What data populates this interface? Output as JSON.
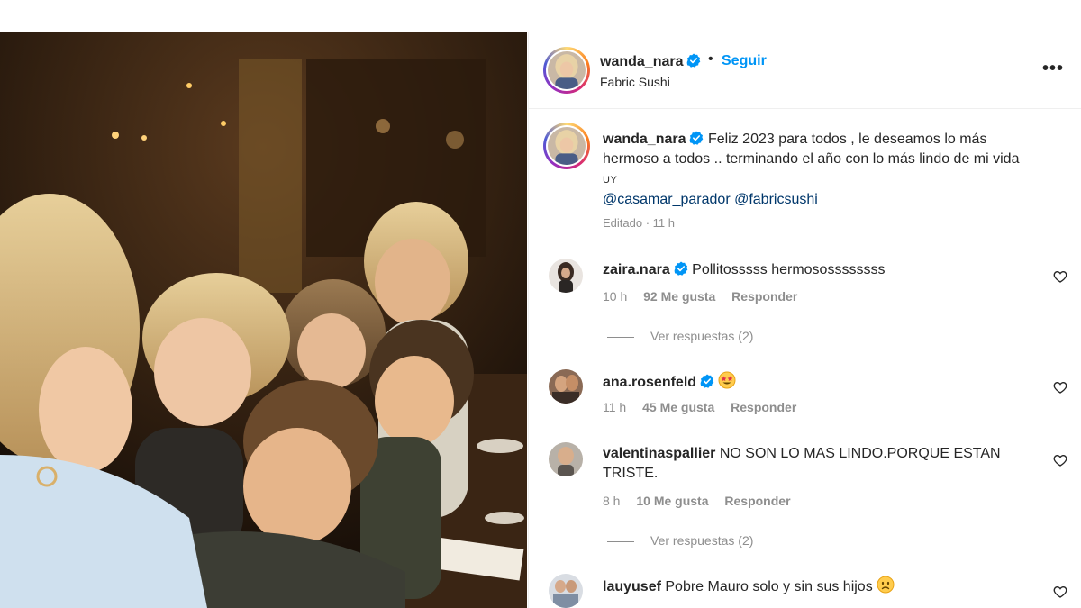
{
  "post": {
    "author": "wanda_nara",
    "follow_label": "Seguir",
    "dot": "•",
    "location": "Fabric Sushi",
    "more_label": "•••"
  },
  "caption": {
    "author": "wanda_nara",
    "text": "Feliz 2023 para todos , le deseamos lo más hermoso a todos .. terminando el año con lo más lindo de mi vida",
    "flag": "UY",
    "mention1": "@casamar_parador",
    "mention2": "@fabricsushi",
    "edited": "Editado",
    "time": "11 h"
  },
  "comments": [
    {
      "user": "zaira.nara",
      "verified": true,
      "text": "Pollitosssss hermosossssssss",
      "time": "10 h",
      "likes": "92 Me gusta",
      "reply": "Responder",
      "view_replies": "Ver respuestas (2)"
    },
    {
      "user": "ana.rosenfeld",
      "verified": true,
      "text": "",
      "emoji": "star-struck-emoji",
      "time": "11 h",
      "likes": "45 Me gusta",
      "reply": "Responder"
    },
    {
      "user": "valentinaspallier",
      "verified": false,
      "text": "NO SON LO MAS LINDO.PORQUE ESTAN TRISTE.",
      "time": "8 h",
      "likes": "10 Me gusta",
      "reply": "Responder",
      "view_replies": "Ver respuestas (2)"
    },
    {
      "user": "lauyusef",
      "verified": false,
      "text": "Pobre Mauro solo y sin sus hijos",
      "emoji": "sad-face-emoji"
    }
  ],
  "colors": {
    "link": "#0095f6",
    "mention": "#00376b",
    "muted": "#8e8e8e",
    "verified": "#0095f6"
  }
}
